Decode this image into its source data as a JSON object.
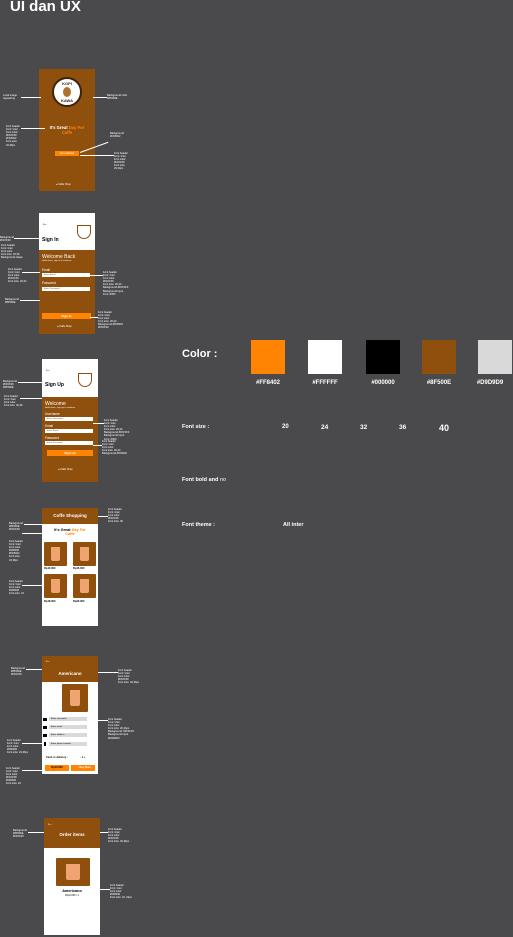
{
  "heading": "UI dan UX",
  "splash": {
    "logo_top": "KOPI",
    "logo_bottom": "KAWA",
    "headline_a": "It's Great ",
    "headline_b": "Day For",
    "headline_c": "Caffe",
    "button": "Get started",
    "footer": "Caffe Shop",
    "note_left1": "Local image\nAppearing",
    "note_left2": "Font header\nFont: Inter\nFont color:\n#FFFFFF\n#FF8402\nFont size:\n32,36px",
    "note_right1": "Background color\n#8F500E",
    "note_right2": "Background\n#FF8402",
    "note_right3": "Font header\nFont: Inter\nFont color:\n#FFFFFF\nFont size:\n20,24px"
  },
  "signin": {
    "title": "Sign In",
    "welcome": "Welcome Back",
    "sub": "Hello there, sign in to continue",
    "email_label": "Email",
    "email_ph": "Enter Email",
    "pass_label": "Password",
    "pass_ph": "Enter Password",
    "button": "Sign In",
    "footer": "Caffe Shop",
    "note_l1": "Background\n#FFFFFF",
    "note_l2": "Font header\nFont: Inter\nFont color\nFont size: 32,36\nBackground shape",
    "note_l3": "Font header\nFont: Inter\nFont color\n#FFFFFF\nFont size: 20,24",
    "note_l4": "Background\n#8F500E",
    "note_r1": "Font header\nFont: Inter\nFont color\n#FFFFFF\nFont size: 20,24\nBackground #FFFFFF\nBackground input\nFont: #000",
    "note_r2": "Font header\nFont: Inter\nFont color\nFont size: 20,24\nBackground #FF8402\n#FFFFFF"
  },
  "signup": {
    "title": "Sign Up",
    "welcome": "Welcome",
    "sub": "Hello there, sign up to continue",
    "user_label": "Username",
    "user_ph": "Enter Username",
    "email_label": "Email",
    "email_ph": "Enter Email",
    "pass_label": "Password",
    "pass_ph": "Enter Password",
    "button": "Sign Up",
    "footer": "Caffe Shop",
    "note_l1": "Background\n#FFFFFF\n#8F500E",
    "note_l2": "Font header\nFont: Inter\nFont color\nFont size: 32,36",
    "note_r1": "Font header\nFont: Inter\nFont color\nFont size: 20,24\nBackground #FFFFFF\nBackground input\nFont: #000",
    "note_r2": "Font header\nFont: Inter\nFont color\nFont size: 20,24\nBackground #FF8402"
  },
  "shop": {
    "title": "Coffe Shopping",
    "headline_a": "It's Great ",
    "headline_b": "Day For",
    "headline_c": "Caffe",
    "prices": [
      "Rp10.000",
      "Rp15.000",
      "Rp18.000",
      "Rp20.000"
    ],
    "note_l1": "Background\n#8F500E\n#FFFFFF",
    "note_l2": "Font header\nFont: Inter\nFont color\n#000000\n#FF8402\nFont size:\n32,36px",
    "note_l3": "Font header\nFont: Inter\nFont color\n#000000\nFont size: 24",
    "note_r1": "Font header\nFont: Inter\nFont color\n#FFFFFF\nFont size: 36"
  },
  "detail": {
    "title": "Americano",
    "fields": [
      "Enter username",
      "Enter email",
      "Enter address",
      "Enter phone number"
    ],
    "cash": "Cash or delivery :",
    "qty": "- 1 +",
    "price": "Rp12.000",
    "buy": "Buy Now",
    "note_l1": "Background\n#8F500E\n#FFFFFF",
    "note_l2": "Font header\nFont: Inter\nFont color\n#000000\nFont size: 24,36px",
    "note_l3": "Font header\nFont: Inter\nFont color\n#FFFFFF\n#000000\nFont size: 24",
    "note_r1": "Font header\nFont: Inter\nFont color\n#FFFFFF\nFont size: 32,36px",
    "note_r2": "Font header\nFont: Inter\nFont color\nFont size: 20,24px\nBackground: #FFFFFF\nBackground input\n#D9D9D9"
  },
  "order": {
    "title": "Order items",
    "name": "Americano",
    "price": "Rp12.000 / 1",
    "note_l1": "Background\n#8F500E\n#FFFFFF",
    "note_r1": "Font header\nFont: Inter\nFont color\n#FFFFFF\nFont size: 32,36px",
    "note_r2": "Font header\nFont: Inter\nFont color\n#000000\nFont size: 24 ,32px"
  },
  "style": {
    "color_heading": "Color :",
    "colors": [
      {
        "hex": "#FF8402",
        "label": "#FF8402"
      },
      {
        "hex": "#FFFFFF",
        "label": "#FFFFFF"
      },
      {
        "hex": "#000000",
        "label": "#000000"
      },
      {
        "hex": "#8F500E",
        "label": "#8F500E"
      },
      {
        "hex": "#D9D9D9",
        "label": "#D9D9D9"
      }
    ],
    "fontsize_label": "Font size :",
    "sizes": [
      "20",
      "24",
      "32",
      "36",
      "40"
    ],
    "bold_label": "Font bold and ",
    "bold_value": "no",
    "theme_label": "Font theme :",
    "theme_value": "All inter"
  }
}
